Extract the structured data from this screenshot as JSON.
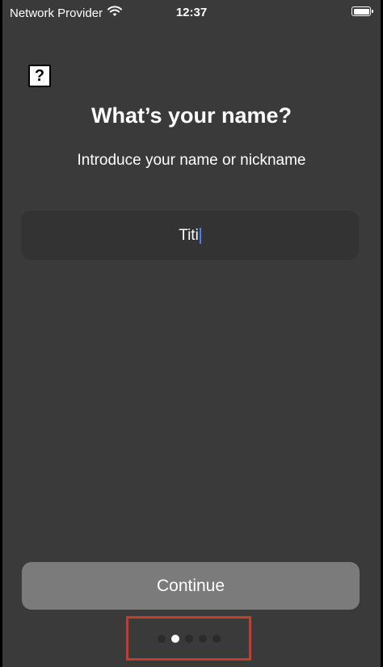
{
  "status_bar": {
    "carrier": "Network Provider",
    "time": "12:37",
    "battery_level": 1.0
  },
  "help_icon": {
    "glyph": "?"
  },
  "title": "What’s your name?",
  "subtitle": "Introduce your name or nickname",
  "name_input": {
    "value": "Titi"
  },
  "continue_label": "Continue",
  "page_indicator": {
    "count": 5,
    "active_index": 1
  },
  "colors": {
    "background": "#3a3a3a",
    "input_background": "#333333",
    "button_background": "#7b7b7b",
    "highlight_border": "#c83a2d",
    "caret": "#4d7cff"
  }
}
